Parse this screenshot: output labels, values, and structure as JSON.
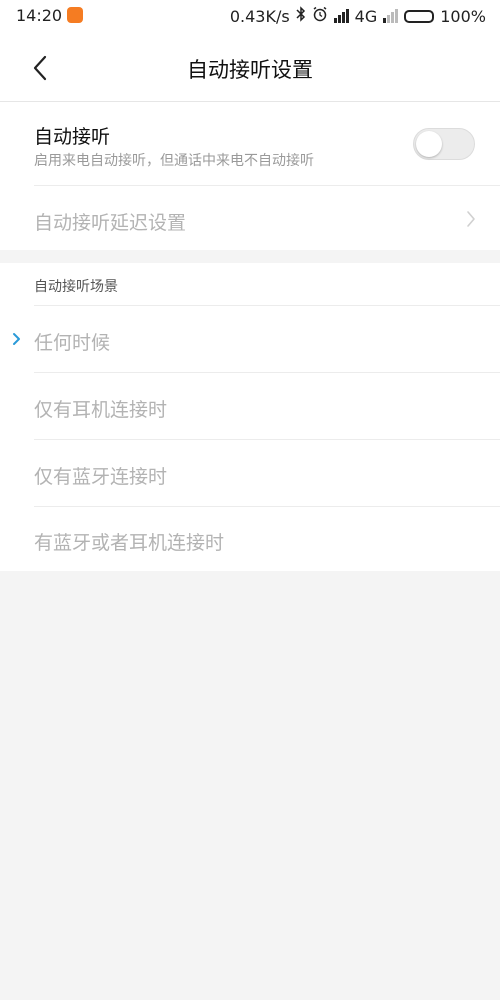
{
  "status_bar": {
    "time": "14:20",
    "net_speed": "0.43K/s",
    "network": "4G",
    "battery": "100%",
    "app_icon_color": "#f57c22"
  },
  "header": {
    "title": "自动接听设置",
    "back_icon": "chevron-left-icon"
  },
  "auto_answer": {
    "title": "自动接听",
    "description": "启用来电自动接听，但通话中来电不自动接听",
    "enabled": false
  },
  "delay_setting": {
    "label": "自动接听延迟设置"
  },
  "scenes": {
    "header": "自动接听场景",
    "options": [
      {
        "label": "任何时候",
        "selected": true
      },
      {
        "label": "仅有耳机连接时",
        "selected": false
      },
      {
        "label": "仅有蓝牙连接时",
        "selected": false
      },
      {
        "label": "有蓝牙或者耳机连接时",
        "selected": false
      }
    ]
  },
  "colors": {
    "accent": "#2a9ad8",
    "background": "#f4f4f4",
    "disabled_text": "#b3b3b3"
  }
}
